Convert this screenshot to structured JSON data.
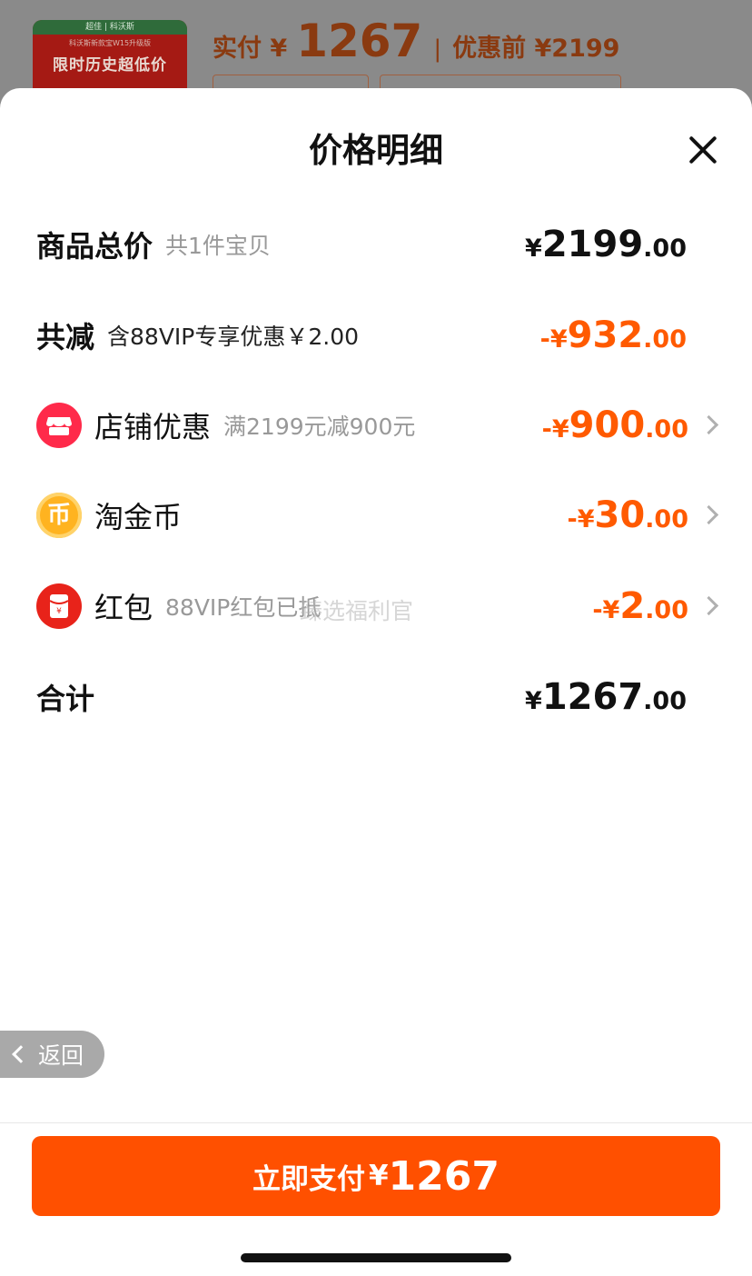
{
  "background": {
    "thumb_header": "超佳 | 科沃斯",
    "thumb_sub": "科沃斯新款宝W15升级版",
    "thumb_title": "限时历史超低价",
    "price_label": "实付 ¥",
    "price_value": "1267",
    "price_separator": "|",
    "price_before": "优惠前 ¥2199"
  },
  "sheet": {
    "title": "价格明细"
  },
  "rows": {
    "total": {
      "label": "商品总价",
      "sub": "共1件宝贝",
      "prefix": "¥",
      "int": "2199",
      "dec": ".00"
    },
    "discount": {
      "label": "共减",
      "sub": "含88VIP专享优惠￥2.00",
      "prefix": "-¥",
      "int": "932",
      "dec": ".00"
    },
    "store": {
      "label": "店铺优惠",
      "sub": "满2199元减900元",
      "prefix": "-¥",
      "int": "900",
      "dec": ".00"
    },
    "coins": {
      "label": "淘金币",
      "sub": "",
      "prefix": "-¥",
      "int": "30",
      "dec": ".00"
    },
    "redpacket": {
      "label": "红包",
      "sub": "88VIP红包已抵",
      "prefix": "-¥",
      "int": "2",
      "dec": ".00"
    },
    "sum": {
      "label": "合计",
      "prefix": "¥",
      "int": "1267",
      "dec": ".00"
    }
  },
  "watermark": "臻选福利官",
  "back": {
    "label": "返回"
  },
  "pay": {
    "label": "立即支付",
    "currency": "¥",
    "amount": "1267"
  },
  "colors": {
    "accent": "#ff5000",
    "discount_text": "#ff5a00",
    "store_icon": "#ff2a4a",
    "coin_icon": "#ffb320",
    "redpacket_icon": "#e8231a"
  },
  "icons": {
    "store": "store-icon",
    "coins": "coin-icon",
    "redpacket": "red-packet-icon",
    "close": "close-icon",
    "chevron": "chevron-right-icon",
    "back": "chevron-left-icon"
  }
}
